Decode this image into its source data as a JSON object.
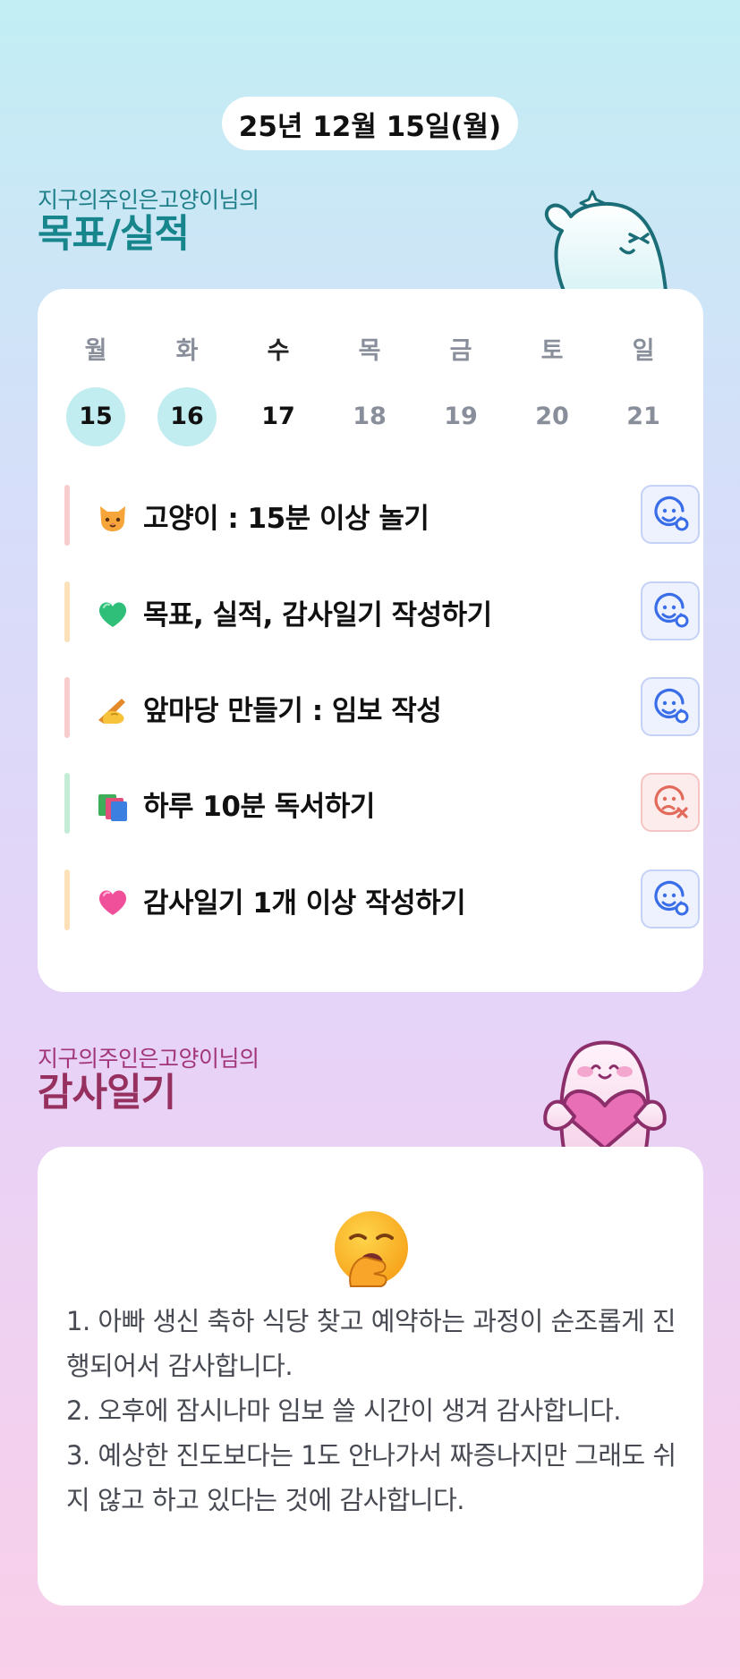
{
  "date_label": "25년 12월 15일(월)",
  "goals_section": {
    "owner": "지구의주인은고양이님의",
    "title": "목표/실적"
  },
  "week": {
    "days": [
      {
        "name": "월",
        "num": "15",
        "state": "done"
      },
      {
        "name": "화",
        "num": "16",
        "state": "done"
      },
      {
        "name": "수",
        "num": "17",
        "state": "today"
      },
      {
        "name": "목",
        "num": "18",
        "state": "future"
      },
      {
        "name": "금",
        "num": "19",
        "state": "future"
      },
      {
        "name": "토",
        "num": "20",
        "state": "future"
      },
      {
        "name": "일",
        "num": "21",
        "state": "future"
      }
    ]
  },
  "goals": [
    {
      "emoji": "cat-face-icon",
      "text": "고양이 : 15분 이상 놀기",
      "bar_color": "#f8cccc",
      "status": "achieved"
    },
    {
      "emoji": "green-heart-icon",
      "text": "목표, 실적, 감사일기 작성하기",
      "bar_color": "#fbe0b8",
      "status": "achieved"
    },
    {
      "emoji": "writing-hand-icon",
      "text": "앞마당 만들기 : 임보 작성",
      "bar_color": "#f8cccc",
      "status": "achieved"
    },
    {
      "emoji": "books-icon",
      "text": "하루 10분 독서하기",
      "bar_color": "#c3ecd6",
      "status": "failed"
    },
    {
      "emoji": "pink-heart-icon",
      "text": "감사일기 1개 이상 작성하기",
      "bar_color": "#fbe0b8",
      "status": "achieved"
    }
  ],
  "gratitude_section": {
    "owner": "지구의주인은고양이님의",
    "title": "감사일기",
    "emoji": "yawning-face-icon",
    "lines": [
      "1. 아빠 생신 축하 식당 찾고 예약하는 과정이 순조롭게 진행되어서 감사합니다.",
      "2. 오후에 잠시나마 임보 쓸 시간이 생겨 감사합니다.",
      "3. 예상한 진도보다는 1도 안나가서 짜증나지만 그래도 쉬지 않고 하고 있다는 것에 감사합니다."
    ]
  },
  "colors": {
    "achieved": "#3a6ee8",
    "failed": "#e26a5a",
    "done_day": "#c1ecf0"
  }
}
